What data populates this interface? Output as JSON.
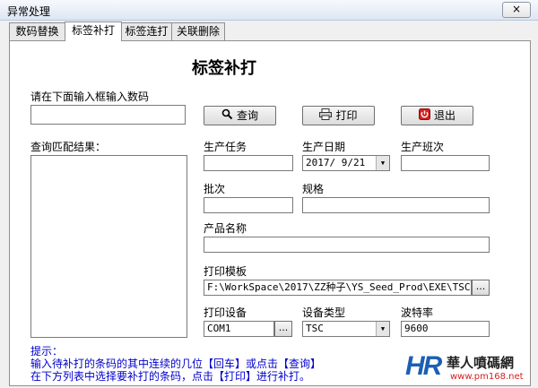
{
  "window": {
    "title": "异常处理",
    "close_glyph": "×"
  },
  "tabs": [
    {
      "label": "数码替换",
      "active": false
    },
    {
      "label": "标签补打",
      "active": true
    },
    {
      "label": "标签连打",
      "active": false
    },
    {
      "label": "关联删除",
      "active": false
    }
  ],
  "main": {
    "heading": "标签补打",
    "search_prompt": "请在下面输入框输入数码",
    "search_value": "",
    "query_button": "查询",
    "print_button": "打印",
    "exit_button": "退出",
    "results_label": "查询匹配结果：",
    "production_task_label": "生产任务",
    "production_task_value": "",
    "production_date_label": "生产日期",
    "production_date_value": "2017/ 9/21",
    "production_shift_label": "生产班次",
    "production_shift_value": "",
    "batch_label": "批次",
    "batch_value": "",
    "spec_label": "规格",
    "spec_value": "",
    "product_name_label": "产品名称",
    "product_name_value": "",
    "template_label": "打印模板",
    "template_value": "F:\\WorkSpace\\2017\\ZZ种子\\YS_Seed_Prod\\EXE\\TSC",
    "browse_label": "...",
    "device_label": "打印设备",
    "device_value": "COM1",
    "device_type_label": "设备类型",
    "device_type_value": "TSC",
    "baud_label": "波特率",
    "baud_value": "9600"
  },
  "hint": {
    "title": "提示：",
    "line1": "输入待补打的条码的其中连续的几位【回车】或点击【查询】",
    "line2": "在下方列表中选择要补打的条码，点击【打印】进行补打。"
  },
  "watermark": {
    "mark": "HR",
    "name": "華人噴碼網",
    "url": "www.pm168.net"
  },
  "colors": {
    "hint_text": "#0000cc",
    "logo_blue": "#1b5fb3",
    "logo_red": "#d62020"
  }
}
